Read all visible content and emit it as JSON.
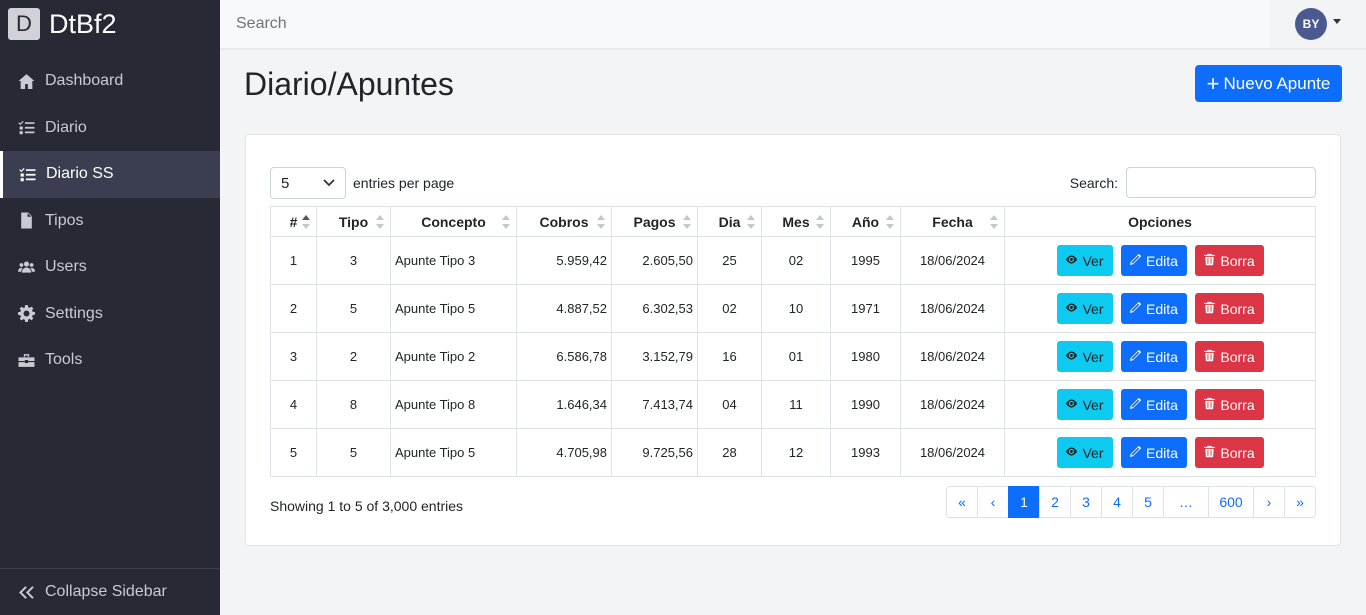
{
  "app": {
    "logo_letter": "D",
    "name": "DtBf2"
  },
  "sidebar": {
    "items": [
      {
        "label": "Dashboard",
        "icon": "home-icon"
      },
      {
        "label": "Diario",
        "icon": "list-check-icon"
      },
      {
        "label": "Diario SS",
        "icon": "list-check-icon",
        "active": true
      },
      {
        "label": "Tipos",
        "icon": "file-icon"
      },
      {
        "label": "Users",
        "icon": "users-icon"
      },
      {
        "label": "Settings",
        "icon": "gear-icon"
      },
      {
        "label": "Tools",
        "icon": "toolbox-icon"
      }
    ],
    "collapse_label": "Collapse Sidebar"
  },
  "topbar": {
    "search_placeholder": "Search",
    "user_initials": "BY"
  },
  "page": {
    "title": "Diario/Apuntes",
    "new_button": "Nuevo Apunte"
  },
  "table_controls": {
    "per_page_value": "5",
    "per_page_label": "entries per page",
    "search_label": "Search:"
  },
  "table": {
    "headers": [
      "#",
      "Tipo",
      "Concepto",
      "Cobros",
      "Pagos",
      "Dia",
      "Mes",
      "Año",
      "Fecha",
      "Opciones"
    ],
    "rows": [
      [
        "1",
        "3",
        "Apunte Tipo 3",
        "5.959,42",
        "2.605,50",
        "25",
        "02",
        "1995",
        "18/06/2024"
      ],
      [
        "2",
        "5",
        "Apunte Tipo 5",
        "4.887,52",
        "6.302,53",
        "02",
        "10",
        "1971",
        "18/06/2024"
      ],
      [
        "3",
        "2",
        "Apunte Tipo 2",
        "6.586,78",
        "3.152,79",
        "16",
        "01",
        "1980",
        "18/06/2024"
      ],
      [
        "4",
        "8",
        "Apunte Tipo 8",
        "1.646,34",
        "7.413,74",
        "04",
        "11",
        "1990",
        "18/06/2024"
      ],
      [
        "5",
        "5",
        "Apunte Tipo 5",
        "4.705,98",
        "9.725,56",
        "28",
        "12",
        "1993",
        "18/06/2024"
      ]
    ],
    "actions": {
      "view": "Ver",
      "edit": "Edita",
      "delete": "Borra"
    }
  },
  "footer": {
    "info": "Showing 1 to 5 of 3,000 entries",
    "pages": [
      "«",
      "‹",
      "1",
      "2",
      "3",
      "4",
      "5",
      "…",
      "600",
      "›",
      "»"
    ],
    "active_page": "1"
  },
  "colors": {
    "primary": "#0d6efd",
    "info": "#0dcaf0",
    "danger": "#dc3545",
    "sidebar": "#272935"
  }
}
